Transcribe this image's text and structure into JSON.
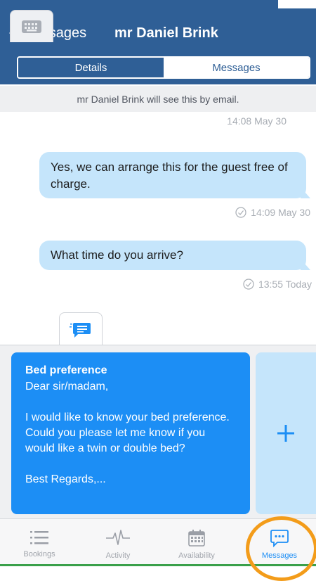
{
  "header": {
    "back_label": "Messages",
    "title": "mr Daniel Brink",
    "segments": [
      "Details",
      "Messages"
    ]
  },
  "notice": "mr Daniel Brink will see this by email.",
  "messages": [
    {
      "timestamp": "14:08  May 30"
    },
    {
      "text": "Yes, we can arrange this for the guest free of charge.",
      "timestamp": "14:09  May 30"
    },
    {
      "text": "What time do you arrive?",
      "timestamp": "13:55  Today"
    }
  ],
  "template": {
    "title": "Bed preference",
    "body": "Dear sir/madam,\n\nI would like to know your bed preference. Could you please let me know if you would like a twin or double bed?\n\nBest Regards,..."
  },
  "tabbar": {
    "items": [
      "Bookings",
      "Activity",
      "Availability",
      "Messages"
    ],
    "selected": "Messages"
  },
  "icons": {
    "back": "chevron-left-icon",
    "check": "check-circle-icon",
    "keyboard": "keyboard-icon",
    "template": "chat-template-icon",
    "add": "plus-icon"
  },
  "colors": {
    "nav": "#2f5f96",
    "bubble": "#c5e5fb",
    "card": "#1c8ef5",
    "highlight": "#f39c1a"
  }
}
